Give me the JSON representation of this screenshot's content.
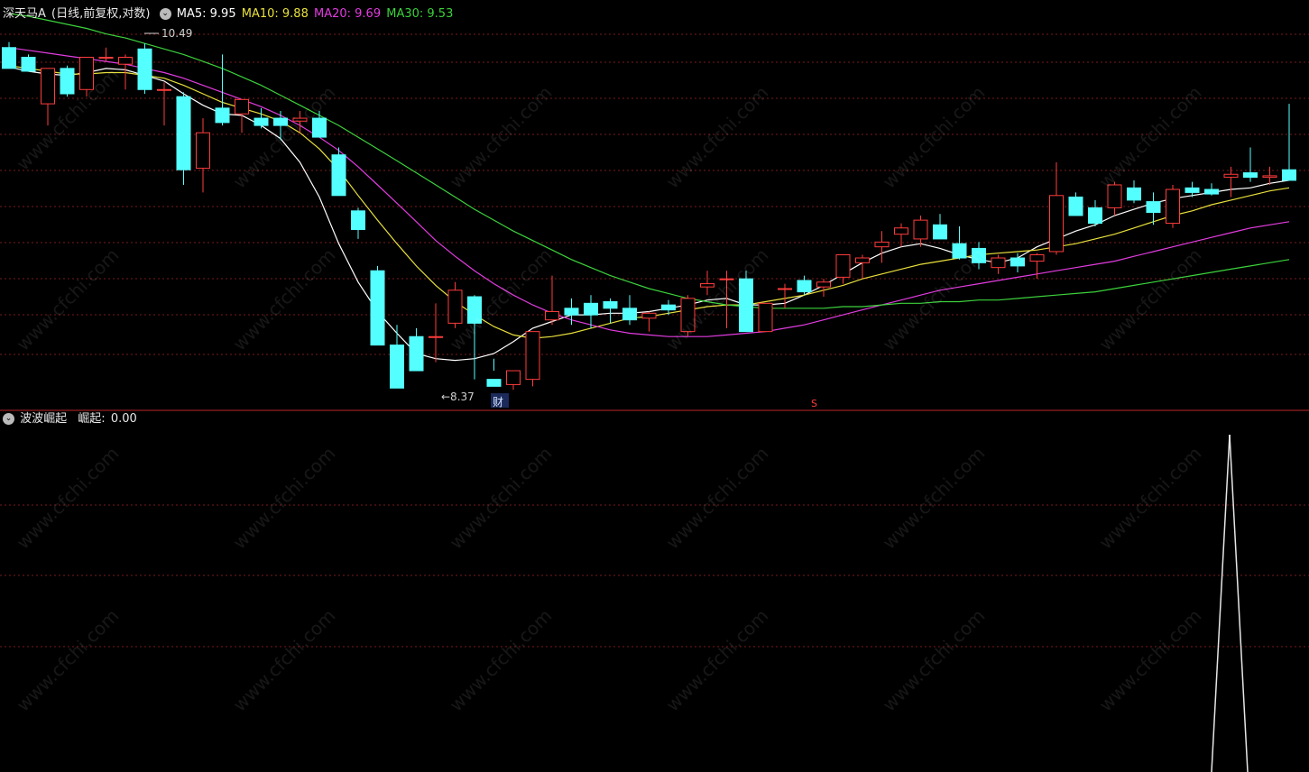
{
  "header": {
    "title": "深天马A",
    "period": "(日线,前复权,对数)",
    "ma5": "MA5: 9.95",
    "ma10": "MA10: 9.88",
    "ma20": "MA20: 9.69",
    "ma30": "MA30: 9.53"
  },
  "indicator": {
    "name": "波波崛起",
    "label": "崛起:",
    "value": "0.00"
  },
  "annotations": {
    "high": "10.49",
    "low": "←8.37",
    "cai_marker": "财",
    "s_marker": "S"
  },
  "watermark": "www.cfchi.com",
  "colors": {
    "up": "#ff3c3c",
    "down": "#54ffff",
    "ma5": "#ffffff",
    "ma10": "#e8e03c",
    "ma20": "#e23ce0",
    "ma30": "#3cd23c",
    "grid": "#7a1a1a",
    "separator": "#c02828",
    "indicator_line": "#e6e6e6"
  },
  "chart_data": [
    {
      "type": "candlestick",
      "title": "深天马A",
      "ylim": [
        8.2,
        10.6
      ],
      "scale": "log",
      "candles": [
        {
          "o": 10.45,
          "h": 10.49,
          "l": 10.3,
          "c": 10.3
        },
        {
          "o": 10.38,
          "h": 10.4,
          "l": 10.28,
          "c": 10.28
        },
        {
          "o": 10.05,
          "h": 10.3,
          "l": 9.9,
          "c": 10.3
        },
        {
          "o": 10.3,
          "h": 10.32,
          "l": 10.1,
          "c": 10.12
        },
        {
          "o": 10.15,
          "h": 10.38,
          "l": 10.1,
          "c": 10.38
        },
        {
          "o": 10.38,
          "h": 10.45,
          "l": 10.35,
          "c": 10.38
        },
        {
          "o": 10.33,
          "h": 10.4,
          "l": 10.15,
          "c": 10.38
        },
        {
          "o": 10.44,
          "h": 10.48,
          "l": 10.12,
          "c": 10.15
        },
        {
          "o": 10.15,
          "h": 10.2,
          "l": 9.9,
          "c": 10.15
        },
        {
          "o": 10.1,
          "h": 10.13,
          "l": 9.5,
          "c": 9.6
        },
        {
          "o": 9.61,
          "h": 9.95,
          "l": 9.45,
          "c": 9.85
        },
        {
          "o": 10.02,
          "h": 10.4,
          "l": 9.9,
          "c": 9.92
        },
        {
          "o": 9.98,
          "h": 10.05,
          "l": 9.85,
          "c": 10.08
        },
        {
          "o": 9.95,
          "h": 10.02,
          "l": 9.88,
          "c": 9.9
        },
        {
          "o": 9.95,
          "h": 10.0,
          "l": 9.8,
          "c": 9.9
        },
        {
          "o": 9.93,
          "h": 10.0,
          "l": 9.85,
          "c": 9.95
        },
        {
          "o": 9.95,
          "h": 10.0,
          "l": 9.85,
          "c": 9.82
        },
        {
          "o": 9.7,
          "h": 9.75,
          "l": 9.45,
          "c": 9.43
        },
        {
          "o": 9.33,
          "h": 9.35,
          "l": 9.15,
          "c": 9.21
        },
        {
          "o": 8.95,
          "h": 8.98,
          "l": 8.5,
          "c": 8.5
        },
        {
          "o": 8.5,
          "h": 8.62,
          "l": 8.25,
          "c": 8.25
        },
        {
          "o": 8.55,
          "h": 8.6,
          "l": 8.37,
          "c": 8.35
        },
        {
          "o": 8.55,
          "h": 8.75,
          "l": 8.4,
          "c": 8.55
        },
        {
          "o": 8.63,
          "h": 8.88,
          "l": 8.6,
          "c": 8.83
        },
        {
          "o": 8.79,
          "h": 8.8,
          "l": 8.3,
          "c": 8.63
        },
        {
          "o": 8.3,
          "h": 8.42,
          "l": 8.35,
          "c": 8.26
        },
        {
          "o": 8.27,
          "h": 8.35,
          "l": 8.24,
          "c": 8.35
        },
        {
          "o": 8.3,
          "h": 8.55,
          "l": 8.26,
          "c": 8.58
        },
        {
          "o": 8.65,
          "h": 8.92,
          "l": 8.62,
          "c": 8.7
        },
        {
          "o": 8.72,
          "h": 8.78,
          "l": 8.62,
          "c": 8.68
        },
        {
          "o": 8.75,
          "h": 8.8,
          "l": 8.6,
          "c": 8.68
        },
        {
          "o": 8.76,
          "h": 8.78,
          "l": 8.63,
          "c": 8.72
        },
        {
          "o": 8.72,
          "h": 8.8,
          "l": 8.62,
          "c": 8.65
        },
        {
          "o": 8.66,
          "h": 8.7,
          "l": 8.58,
          "c": 8.69
        },
        {
          "o": 8.74,
          "h": 8.77,
          "l": 8.68,
          "c": 8.71
        },
        {
          "o": 8.58,
          "h": 8.8,
          "l": 8.55,
          "c": 8.78
        },
        {
          "o": 8.85,
          "h": 8.95,
          "l": 8.8,
          "c": 8.87
        },
        {
          "o": 8.9,
          "h": 8.95,
          "l": 8.6,
          "c": 8.9
        },
        {
          "o": 8.9,
          "h": 8.95,
          "l": 8.58,
          "c": 8.58
        },
        {
          "o": 8.58,
          "h": 8.72,
          "l": 8.58,
          "c": 8.75
        },
        {
          "o": 8.84,
          "h": 8.87,
          "l": 8.72,
          "c": 8.84
        },
        {
          "o": 8.89,
          "h": 8.92,
          "l": 8.8,
          "c": 8.82
        },
        {
          "o": 8.85,
          "h": 8.9,
          "l": 8.79,
          "c": 8.88
        },
        {
          "o": 8.91,
          "h": 9.0,
          "l": 8.87,
          "c": 9.05
        },
        {
          "o": 9.0,
          "h": 9.05,
          "l": 8.9,
          "c": 9.03
        },
        {
          "o": 9.1,
          "h": 9.2,
          "l": 9.0,
          "c": 9.13
        },
        {
          "o": 9.18,
          "h": 9.25,
          "l": 9.1,
          "c": 9.22
        },
        {
          "o": 9.15,
          "h": 9.3,
          "l": 9.1,
          "c": 9.27
        },
        {
          "o": 9.24,
          "h": 9.31,
          "l": 9.2,
          "c": 9.15
        },
        {
          "o": 9.12,
          "h": 9.23,
          "l": 9.02,
          "c": 9.03
        },
        {
          "o": 9.09,
          "h": 9.13,
          "l": 8.96,
          "c": 9.0
        },
        {
          "o": 8.97,
          "h": 9.05,
          "l": 8.93,
          "c": 9.03
        },
        {
          "o": 9.03,
          "h": 9.06,
          "l": 8.94,
          "c": 8.98
        },
        {
          "o": 9.01,
          "h": 9.06,
          "l": 8.9,
          "c": 9.05
        },
        {
          "o": 9.07,
          "h": 9.65,
          "l": 9.05,
          "c": 9.43
        },
        {
          "o": 9.42,
          "h": 9.45,
          "l": 9.3,
          "c": 9.3
        },
        {
          "o": 9.35,
          "h": 9.4,
          "l": 9.23,
          "c": 9.25
        },
        {
          "o": 9.35,
          "h": 9.52,
          "l": 9.3,
          "c": 9.5
        },
        {
          "o": 9.48,
          "h": 9.53,
          "l": 9.38,
          "c": 9.4
        },
        {
          "o": 9.39,
          "h": 9.45,
          "l": 9.24,
          "c": 9.32
        },
        {
          "o": 9.25,
          "h": 9.5,
          "l": 9.22,
          "c": 9.47
        },
        {
          "o": 9.48,
          "h": 9.52,
          "l": 9.42,
          "c": 9.45
        },
        {
          "o": 9.47,
          "h": 9.51,
          "l": 9.43,
          "c": 9.44
        },
        {
          "o": 9.55,
          "h": 9.62,
          "l": 9.42,
          "c": 9.57
        },
        {
          "o": 9.58,
          "h": 9.75,
          "l": 9.52,
          "c": 9.55
        },
        {
          "o": 9.55,
          "h": 9.62,
          "l": 9.5,
          "c": 9.56
        },
        {
          "o": 9.6,
          "h": 10.05,
          "l": 9.58,
          "c": 9.53
        }
      ],
      "series": [
        {
          "name": "MA5",
          "values": [
            10.31,
            10.28,
            10.26,
            10.25,
            10.27,
            10.3,
            10.29,
            10.25,
            10.21,
            10.12,
            10.04,
            9.98,
            9.97,
            9.9,
            9.81,
            9.65,
            9.42,
            9.12,
            8.88,
            8.7,
            8.57,
            8.45,
            8.42,
            8.41,
            8.42,
            8.45,
            8.52,
            8.6,
            8.64,
            8.68,
            8.68,
            8.69,
            8.69,
            8.7,
            8.72,
            8.74,
            8.77,
            8.78,
            8.74,
            8.74,
            8.75,
            8.8,
            8.86,
            8.93,
            9.0,
            9.06,
            9.1,
            9.12,
            9.09,
            9.05,
            9.02,
            9.0,
            9.03,
            9.1,
            9.15,
            9.2,
            9.24,
            9.3,
            9.34,
            9.38,
            9.41,
            9.43,
            9.45,
            9.47,
            9.48,
            9.51,
            9.53
          ]
        },
        {
          "name": "MA10",
          "values": [
            10.32,
            10.3,
            10.28,
            10.26,
            10.26,
            10.27,
            10.27,
            10.25,
            10.23,
            10.18,
            10.12,
            10.06,
            10.02,
            9.98,
            9.93,
            9.85,
            9.74,
            9.6,
            9.43,
            9.27,
            9.12,
            8.98,
            8.86,
            8.76,
            8.68,
            8.61,
            8.56,
            8.54,
            8.55,
            8.57,
            8.6,
            8.63,
            8.66,
            8.67,
            8.69,
            8.71,
            8.73,
            8.74,
            8.74,
            8.76,
            8.78,
            8.8,
            8.83,
            8.86,
            8.9,
            8.93,
            8.96,
            8.99,
            9.01,
            9.03,
            9.05,
            9.06,
            9.07,
            9.08,
            9.1,
            9.12,
            9.15,
            9.18,
            9.22,
            9.26,
            9.3,
            9.33,
            9.37,
            9.4,
            9.43,
            9.46,
            9.48
          ]
        },
        {
          "name": "MA20",
          "values": [
            10.45,
            10.43,
            10.41,
            10.39,
            10.37,
            10.35,
            10.33,
            10.3,
            10.27,
            10.23,
            10.18,
            10.13,
            10.08,
            10.03,
            9.97,
            9.9,
            9.82,
            9.73,
            9.62,
            9.5,
            9.38,
            9.26,
            9.14,
            9.04,
            8.95,
            8.87,
            8.8,
            8.74,
            8.69,
            8.65,
            8.62,
            8.59,
            8.57,
            8.56,
            8.55,
            8.55,
            8.55,
            8.56,
            8.57,
            8.58,
            8.6,
            8.62,
            8.65,
            8.68,
            8.71,
            8.74,
            8.77,
            8.8,
            8.83,
            8.85,
            8.87,
            8.89,
            8.91,
            8.93,
            8.95,
            8.97,
            8.99,
            9.01,
            9.04,
            9.07,
            9.1,
            9.13,
            9.16,
            9.19,
            9.22,
            9.24,
            9.26
          ]
        },
        {
          "name": "MA30",
          "values": [
            10.7,
            10.68,
            10.65,
            10.62,
            10.59,
            10.55,
            10.52,
            10.48,
            10.44,
            10.4,
            10.35,
            10.3,
            10.24,
            10.18,
            10.11,
            10.04,
            9.97,
            9.9,
            9.82,
            9.74,
            9.66,
            9.58,
            9.5,
            9.42,
            9.34,
            9.27,
            9.2,
            9.14,
            9.08,
            9.02,
            8.97,
            8.92,
            8.88,
            8.84,
            8.81,
            8.78,
            8.76,
            8.74,
            8.73,
            8.72,
            8.72,
            8.72,
            8.72,
            8.73,
            8.73,
            8.74,
            8.75,
            8.75,
            8.76,
            8.76,
            8.77,
            8.77,
            8.78,
            8.79,
            8.8,
            8.81,
            8.82,
            8.84,
            8.86,
            8.88,
            8.9,
            8.92,
            8.94,
            8.96,
            8.98,
            9.0,
            9.02
          ]
        }
      ]
    },
    {
      "type": "line",
      "title": "波波崛起",
      "series": [
        {
          "name": "崛起",
          "values": [
            0,
            0,
            0,
            0,
            0,
            0,
            0,
            0,
            0,
            0,
            0,
            0,
            0,
            0,
            0,
            0,
            0,
            0,
            0,
            0,
            0,
            0,
            0,
            0,
            0,
            0,
            0,
            0,
            0,
            0,
            0,
            0,
            0,
            0,
            0,
            0,
            0,
            0,
            0,
            0,
            0,
            0,
            0,
            0,
            0,
            0,
            0,
            0,
            0,
            0,
            0,
            0,
            0,
            0,
            0,
            0,
            0,
            0,
            0,
            0,
            0,
            0,
            1,
            0,
            0,
            0,
            0
          ]
        }
      ],
      "ylim": [
        0,
        1
      ]
    }
  ]
}
